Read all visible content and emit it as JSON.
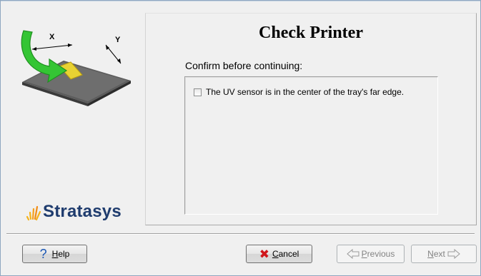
{
  "illustration": {
    "axis_x": "X",
    "axis_y": "Y"
  },
  "brand": {
    "name": "Stratasys",
    "color": "#1f3c6e",
    "accent": "#f5b21a"
  },
  "page": {
    "title": "Check Printer",
    "subtitle": "Confirm before continuing:"
  },
  "checklist": [
    {
      "label": "The UV sensor is in the center of the tray's far edge.",
      "checked": false
    }
  ],
  "buttons": {
    "help": {
      "prefix": "",
      "mnemonic": "H",
      "rest": "elp",
      "icon": "help-question-icon"
    },
    "cancel": {
      "mnemonic": "C",
      "rest": "ancel",
      "icon": "red-x-icon"
    },
    "previous": {
      "mnemonic": "P",
      "rest": "revious",
      "icon": "arrow-left-outline-icon",
      "enabled": false
    },
    "next": {
      "mnemonic": "N",
      "rest": "ext",
      "icon": "arrow-right-outline-icon",
      "enabled": false
    }
  }
}
